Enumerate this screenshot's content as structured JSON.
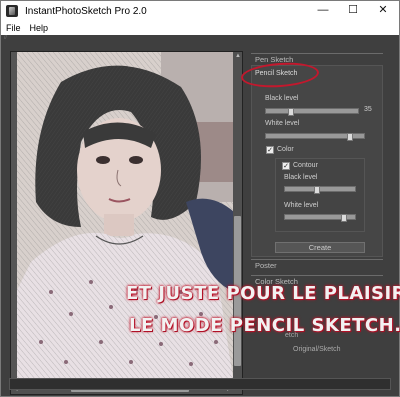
{
  "window": {
    "title": "InstantPhotoSketch Pro 2.0"
  },
  "menu": [
    {
      "label": "File"
    },
    {
      "label": "Help"
    }
  ],
  "grip": "//",
  "panel": {
    "pen_sketch": "Pen Sketch",
    "pencil_sketch": "Pencil Sketch",
    "black_level_label": "Black level",
    "black_level_value": "35",
    "black_level": 0.25,
    "white_level_label": "White level",
    "white_level": 0.88,
    "color_label": "Color",
    "color_checked": true,
    "contour_label": "Contour",
    "contour_checked": true,
    "contour_black_level_label": "Black level",
    "contour_black_level": 0.45,
    "contour_white_level_label": "White level",
    "contour_white_level": 0.88,
    "create_label": "Create",
    "poster": "Poster",
    "color_sketch": "Color Sketch",
    "sketch_partial": "etch",
    "original_sketch": "Original/Sketch"
  },
  "overlay": {
    "line1": "ET JUSTE POUR LE PLAISIR,",
    "line2": "LE MODE PENCIL SKETCH."
  },
  "colors": {
    "accent": "#c3182d",
    "panel": "#3f3f3f"
  }
}
